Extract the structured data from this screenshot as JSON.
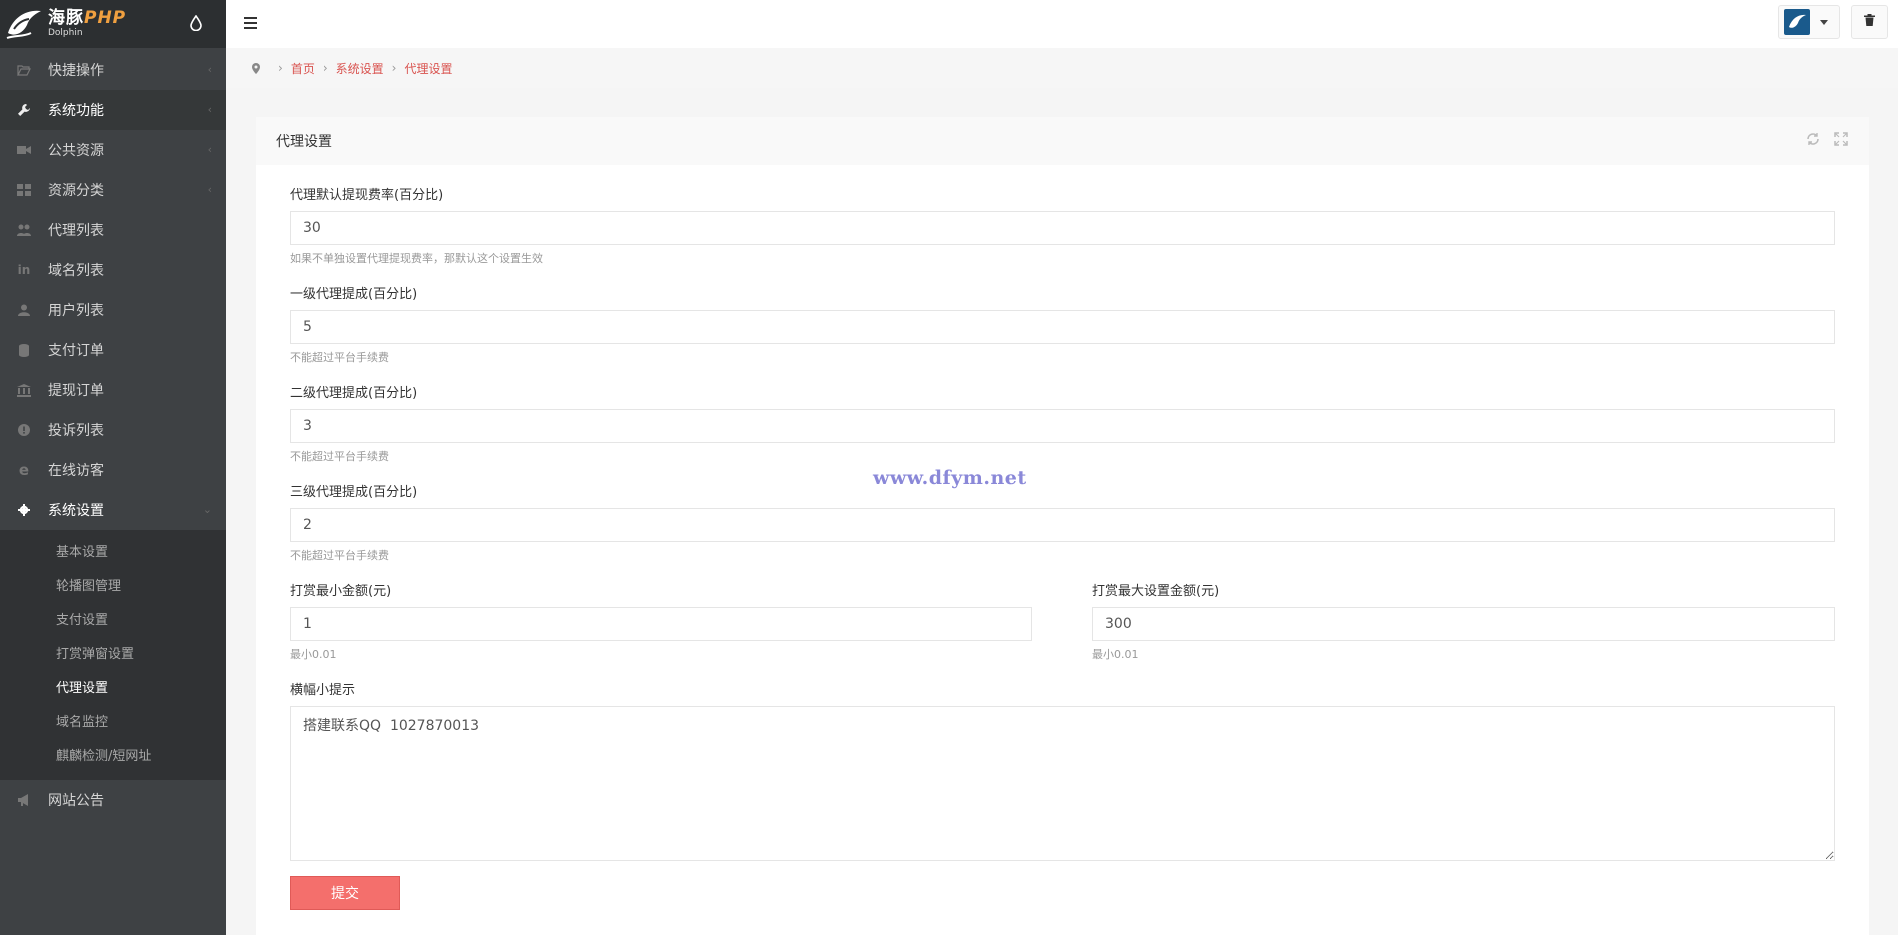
{
  "brand": {
    "name_cn": "海豚",
    "name_php": "PHP",
    "sub": "Dolphin"
  },
  "sidebar": {
    "items": [
      {
        "label": "快捷操作",
        "icon": "folder-open-icon",
        "has_arrow": true
      },
      {
        "label": "系统功能",
        "icon": "wrench-icon",
        "has_arrow": true
      },
      {
        "label": "公共资源",
        "icon": "video-camera-icon",
        "has_arrow": true
      },
      {
        "label": "资源分类",
        "icon": "grid-icon",
        "has_arrow": true
      },
      {
        "label": "代理列表",
        "icon": "users-icon",
        "has_arrow": false
      },
      {
        "label": "域名列表",
        "icon": "linkedin-icon",
        "has_arrow": false
      },
      {
        "label": "用户列表",
        "icon": "user-icon",
        "has_arrow": false
      },
      {
        "label": "支付订单",
        "icon": "database-icon",
        "has_arrow": false
      },
      {
        "label": "提现订单",
        "icon": "bank-icon",
        "has_arrow": false
      },
      {
        "label": "投诉列表",
        "icon": "alert-circle-icon",
        "has_arrow": false
      },
      {
        "label": "在线访客",
        "icon": "ie-icon",
        "has_arrow": false
      },
      {
        "label": "系统设置",
        "icon": "gear-icon",
        "has_arrow": true
      }
    ],
    "sub_items": [
      "基本设置",
      "轮播图管理",
      "支付设置",
      "打赏弹窗设置",
      "代理设置",
      "域名监控",
      "麒麟检测/短网址"
    ],
    "last_item": {
      "label": "网站公告",
      "icon": "bullhorn-icon"
    }
  },
  "breadcrumb": {
    "home": "首页",
    "level1": "系统设置",
    "level2": "代理设置"
  },
  "card": {
    "title": "代理设置"
  },
  "form": {
    "withdraw_rate": {
      "label": "代理默认提现费率(百分比)",
      "value": "30",
      "hint": "如果不单独设置代理提现费率，那默认这个设置生效"
    },
    "level1": {
      "label": "一级代理提成(百分比)",
      "value": "5",
      "hint": "不能超过平台手续费"
    },
    "level2": {
      "label": "二级代理提成(百分比)",
      "value": "3",
      "hint": "不能超过平台手续费"
    },
    "level3": {
      "label": "三级代理提成(百分比)",
      "value": "2",
      "hint": "不能超过平台手续费"
    },
    "tip_min": {
      "label": "打赏最小金额(元)",
      "value": "1",
      "hint": "最小0.01"
    },
    "tip_max": {
      "label": "打赏最大设置金额(元)",
      "value": "300",
      "hint": "最小0.01"
    },
    "banner": {
      "label": "横幅小提示",
      "value": "搭建联系QQ  1027870013"
    },
    "submit_label": "提交"
  },
  "watermark": "www.dfym.net",
  "colors": {
    "sidebar_bg": "#3e4144",
    "accent": "#f46f6c",
    "link": "#d9534f"
  }
}
